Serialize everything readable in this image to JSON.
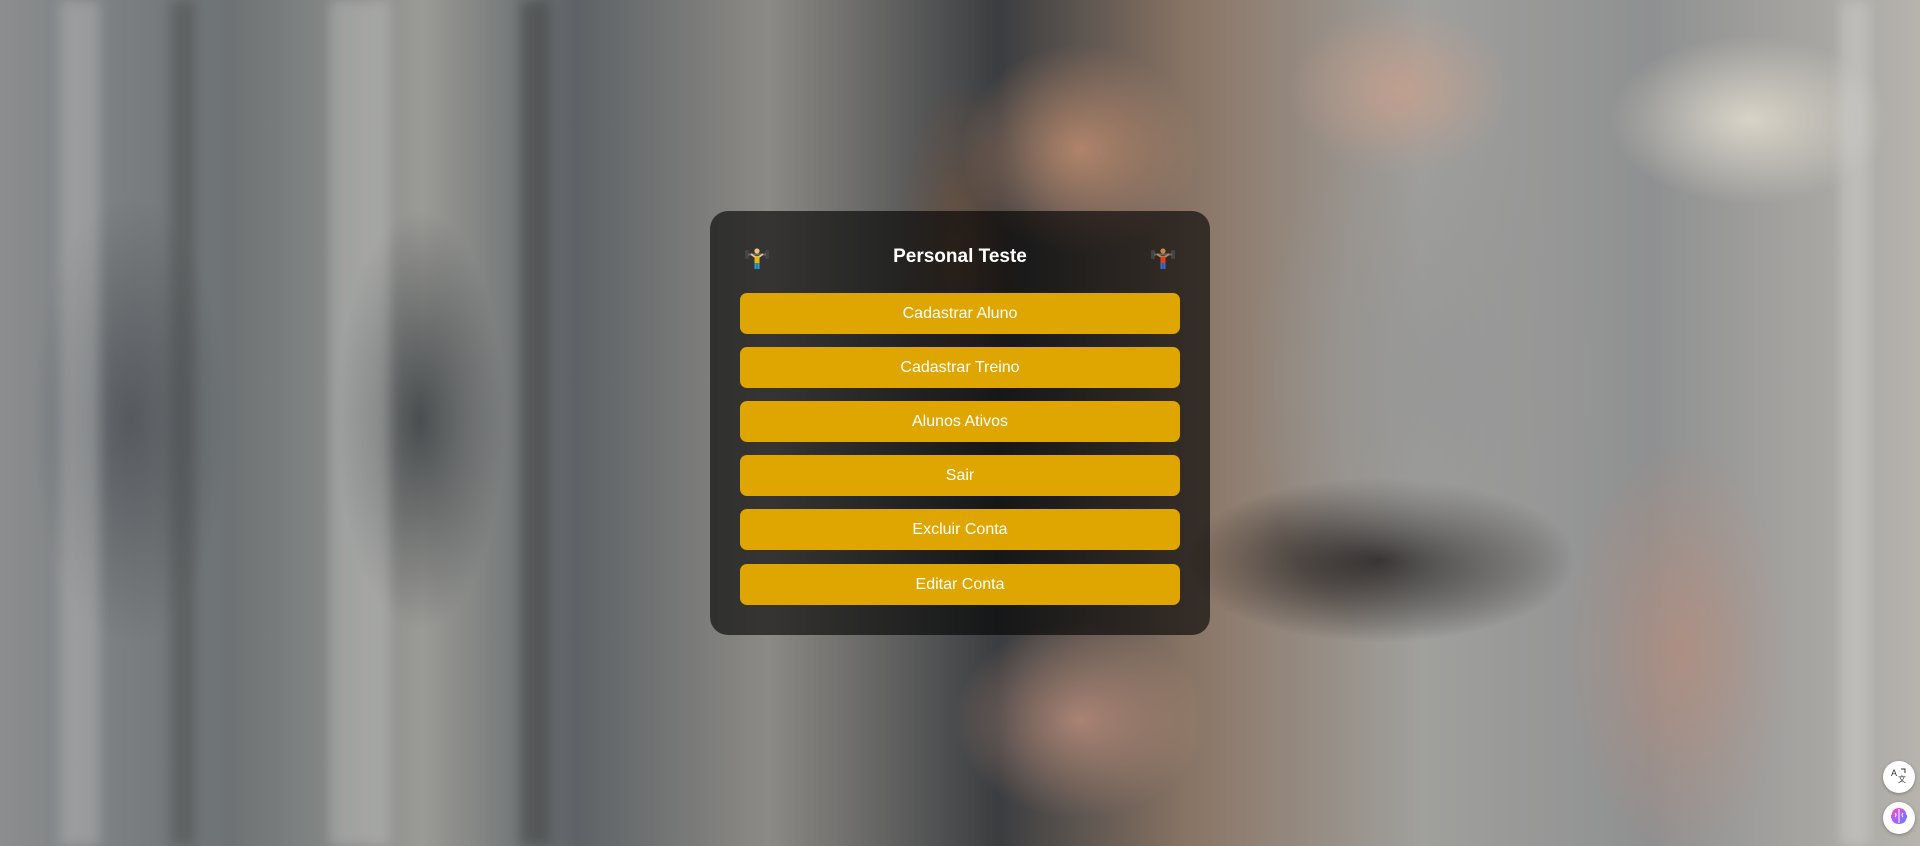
{
  "page": {
    "title": "Personal Teste"
  },
  "menu": {
    "buttons": [
      {
        "label": "Cadastrar Aluno"
      },
      {
        "label": "Cadastrar Treino"
      },
      {
        "label": "Alunos Ativos"
      },
      {
        "label": "Sair"
      },
      {
        "label": "Excluir Conta"
      },
      {
        "label": "Editar Conta"
      }
    ]
  },
  "icons": {
    "header_left": "weightlifter-icon",
    "header_right": "weightlifter-icon",
    "floating_top": "translate-icon",
    "floating_bottom": "brain-icon"
  },
  "colors": {
    "button_background": "#dfa500",
    "button_text": "#ffffff",
    "panel_background": "rgba(0,0,0,0.62)"
  }
}
